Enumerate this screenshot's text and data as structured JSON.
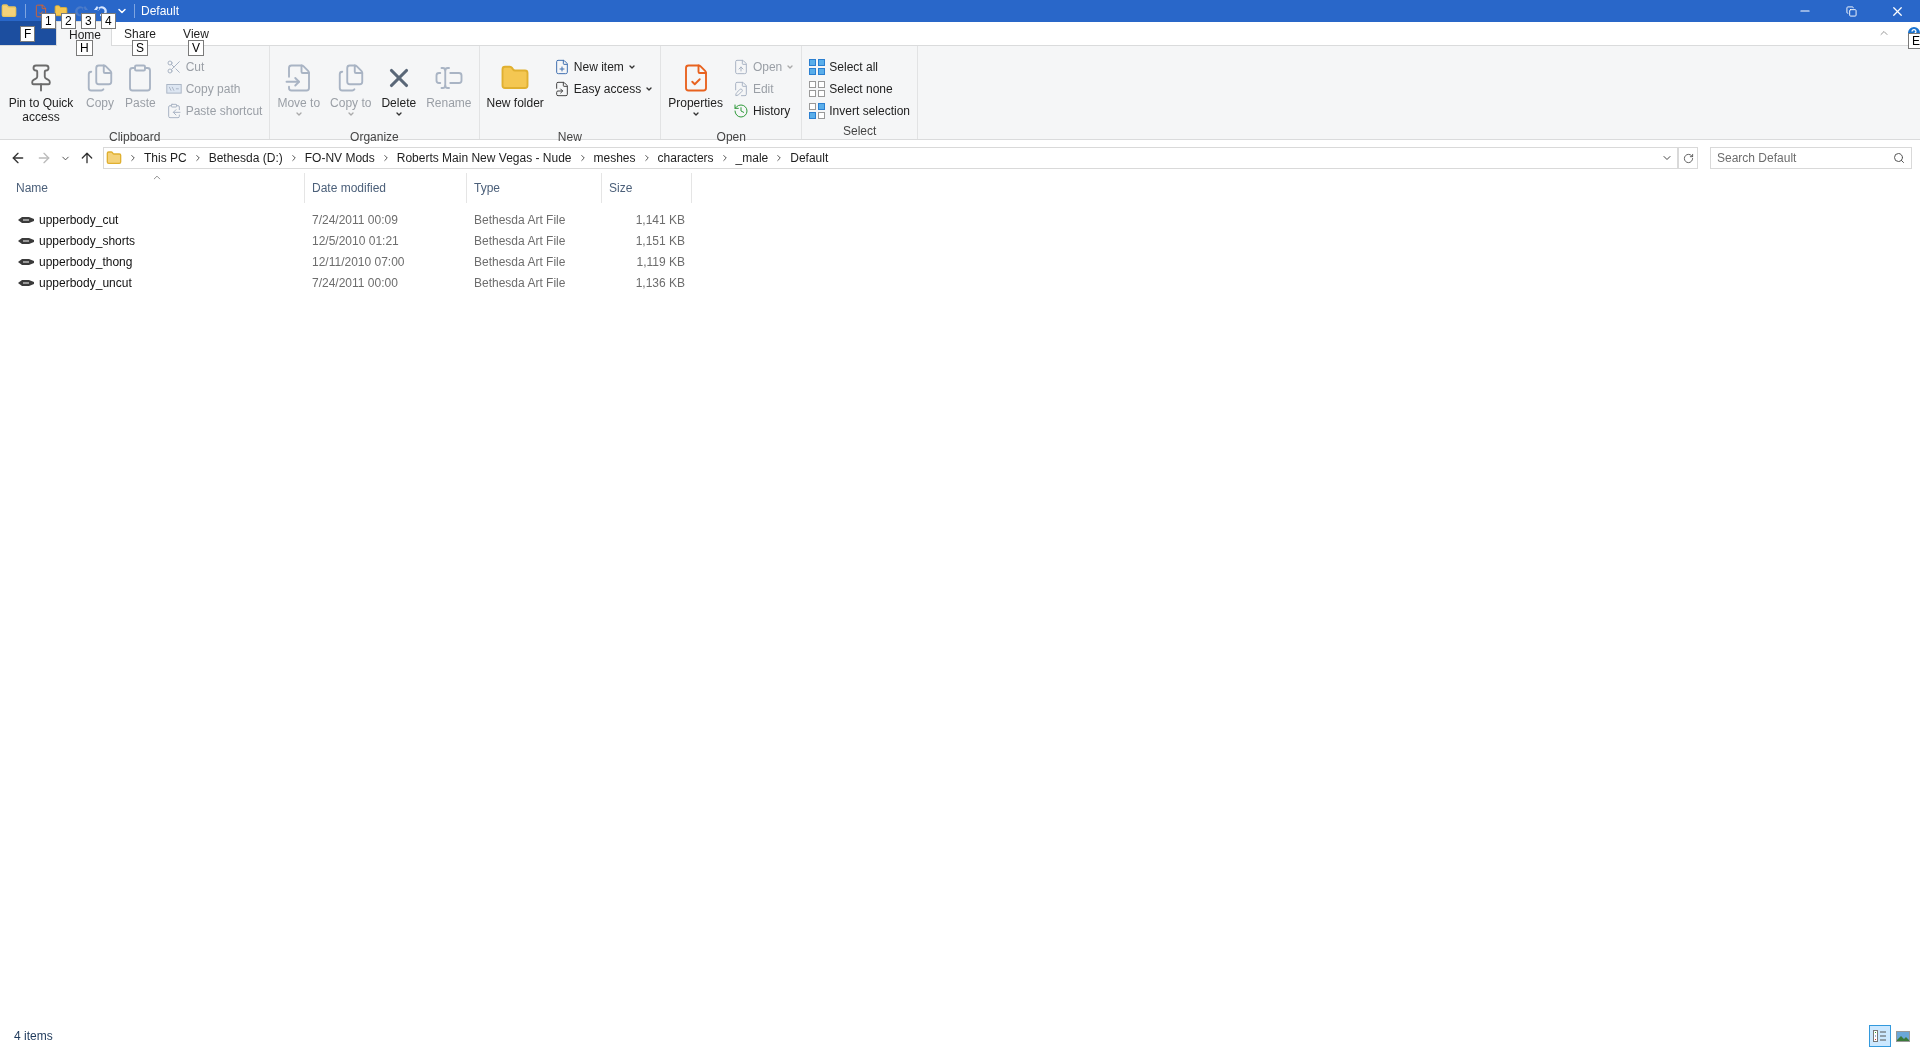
{
  "window": {
    "title": "Default"
  },
  "quick_access": [
    {
      "kind": "properties",
      "keytip": "1",
      "disabled": false
    },
    {
      "kind": "new-folder",
      "keytip": "2",
      "disabled": false
    },
    {
      "kind": "redo",
      "keytip": "3",
      "disabled": true
    },
    {
      "kind": "undo",
      "keytip": "4",
      "disabled": false
    }
  ],
  "file_tab": {
    "keytip": "F"
  },
  "tabs": [
    {
      "label": "Home",
      "keytip": "H",
      "selected": true
    },
    {
      "label": "Share",
      "keytip": "S",
      "selected": false
    },
    {
      "label": "View",
      "keytip": "V",
      "selected": false
    }
  ],
  "help": {
    "keytip": "E"
  },
  "ribbon_groups": [
    {
      "label": "Clipboard",
      "columns": [
        [
          {
            "kind": "pin",
            "label": "Pin to Quick access",
            "disabled": false,
            "dropdown": false
          }
        ],
        [
          {
            "kind": "copy",
            "label": "Copy",
            "disabled": true,
            "dropdown": false
          }
        ],
        [
          {
            "kind": "paste",
            "label": "Paste",
            "disabled": true,
            "dropdown": false
          }
        ],
        [
          {
            "kind": "cut",
            "label": "Cut",
            "disabled": true,
            "dropdown": false
          },
          {
            "kind": "copy-path",
            "label": "Copy path",
            "disabled": true,
            "dropdown": false
          },
          {
            "kind": "paste-shortcut",
            "label": "Paste shortcut",
            "disabled": true,
            "dropdown": false
          }
        ]
      ]
    },
    {
      "label": "Organize",
      "columns": [
        [
          {
            "kind": "move-to",
            "label": "Move to",
            "disabled": true,
            "dropdown": true
          }
        ],
        [
          {
            "kind": "copy-to",
            "label": "Copy to",
            "disabled": true,
            "dropdown": true
          }
        ],
        [
          {
            "kind": "delete",
            "label": "Delete",
            "disabled": false,
            "dropdown": true
          }
        ],
        [
          {
            "kind": "rename",
            "label": "Rename",
            "disabled": true,
            "dropdown": false
          }
        ]
      ]
    },
    {
      "label": "New",
      "columns": [
        [
          {
            "kind": "new-folder",
            "label": "New folder",
            "disabled": false,
            "dropdown": false
          }
        ],
        [
          {
            "kind": "new-item",
            "label": "New item",
            "disabled": false,
            "dropdown": true
          },
          {
            "kind": "easy-access",
            "label": "Easy access",
            "disabled": false,
            "dropdown": true
          }
        ]
      ]
    },
    {
      "label": "Open",
      "columns": [
        [
          {
            "kind": "properties",
            "label": "Properties",
            "disabled": false,
            "dropdown": true
          }
        ],
        [
          {
            "kind": "open",
            "label": "Open",
            "disabled": true,
            "dropdown": true
          },
          {
            "kind": "edit",
            "label": "Edit",
            "disabled": true,
            "dropdown": false
          },
          {
            "kind": "history",
            "label": "History",
            "disabled": false,
            "dropdown": false
          }
        ]
      ]
    },
    {
      "label": "Select",
      "columns": [
        [
          {
            "kind": "select-all",
            "label": "Select all",
            "disabled": false,
            "dropdown": false
          },
          {
            "kind": "select-none",
            "label": "Select none",
            "disabled": false,
            "dropdown": false
          },
          {
            "kind": "invert-selection",
            "label": "Invert selection",
            "disabled": false,
            "dropdown": false
          }
        ]
      ]
    }
  ],
  "address_bar": {
    "crumbs": [
      "This PC",
      "Bethesda (D:)",
      "FO-NV Mods",
      "Roberts Main New Vegas - Nude",
      "meshes",
      "characters",
      "_male",
      "Default"
    ]
  },
  "search": {
    "placeholder": "Search Default"
  },
  "columns": [
    {
      "label": "Name",
      "sorted": true
    },
    {
      "label": "Date modified",
      "sorted": false
    },
    {
      "label": "Type",
      "sorted": false
    },
    {
      "label": "Size",
      "sorted": false
    }
  ],
  "rows": [
    {
      "name": "upperbody_cut",
      "date": "7/24/2011 00:09",
      "type": "Bethesda Art File",
      "size": "1,141 KB"
    },
    {
      "name": "upperbody_shorts",
      "date": "12/5/2010 01:21",
      "type": "Bethesda Art File",
      "size": "1,151 KB"
    },
    {
      "name": "upperbody_thong",
      "date": "12/11/2010 07:00",
      "type": "Bethesda Art File",
      "size": "1,119 KB"
    },
    {
      "name": "upperbody_uncut",
      "date": "7/24/2011 00:00",
      "type": "Bethesda Art File",
      "size": "1,136 KB"
    }
  ],
  "status_bar": {
    "count": "4 items"
  },
  "views": [
    {
      "kind": "details",
      "selected": true
    },
    {
      "kind": "large-icons",
      "selected": false
    }
  ]
}
